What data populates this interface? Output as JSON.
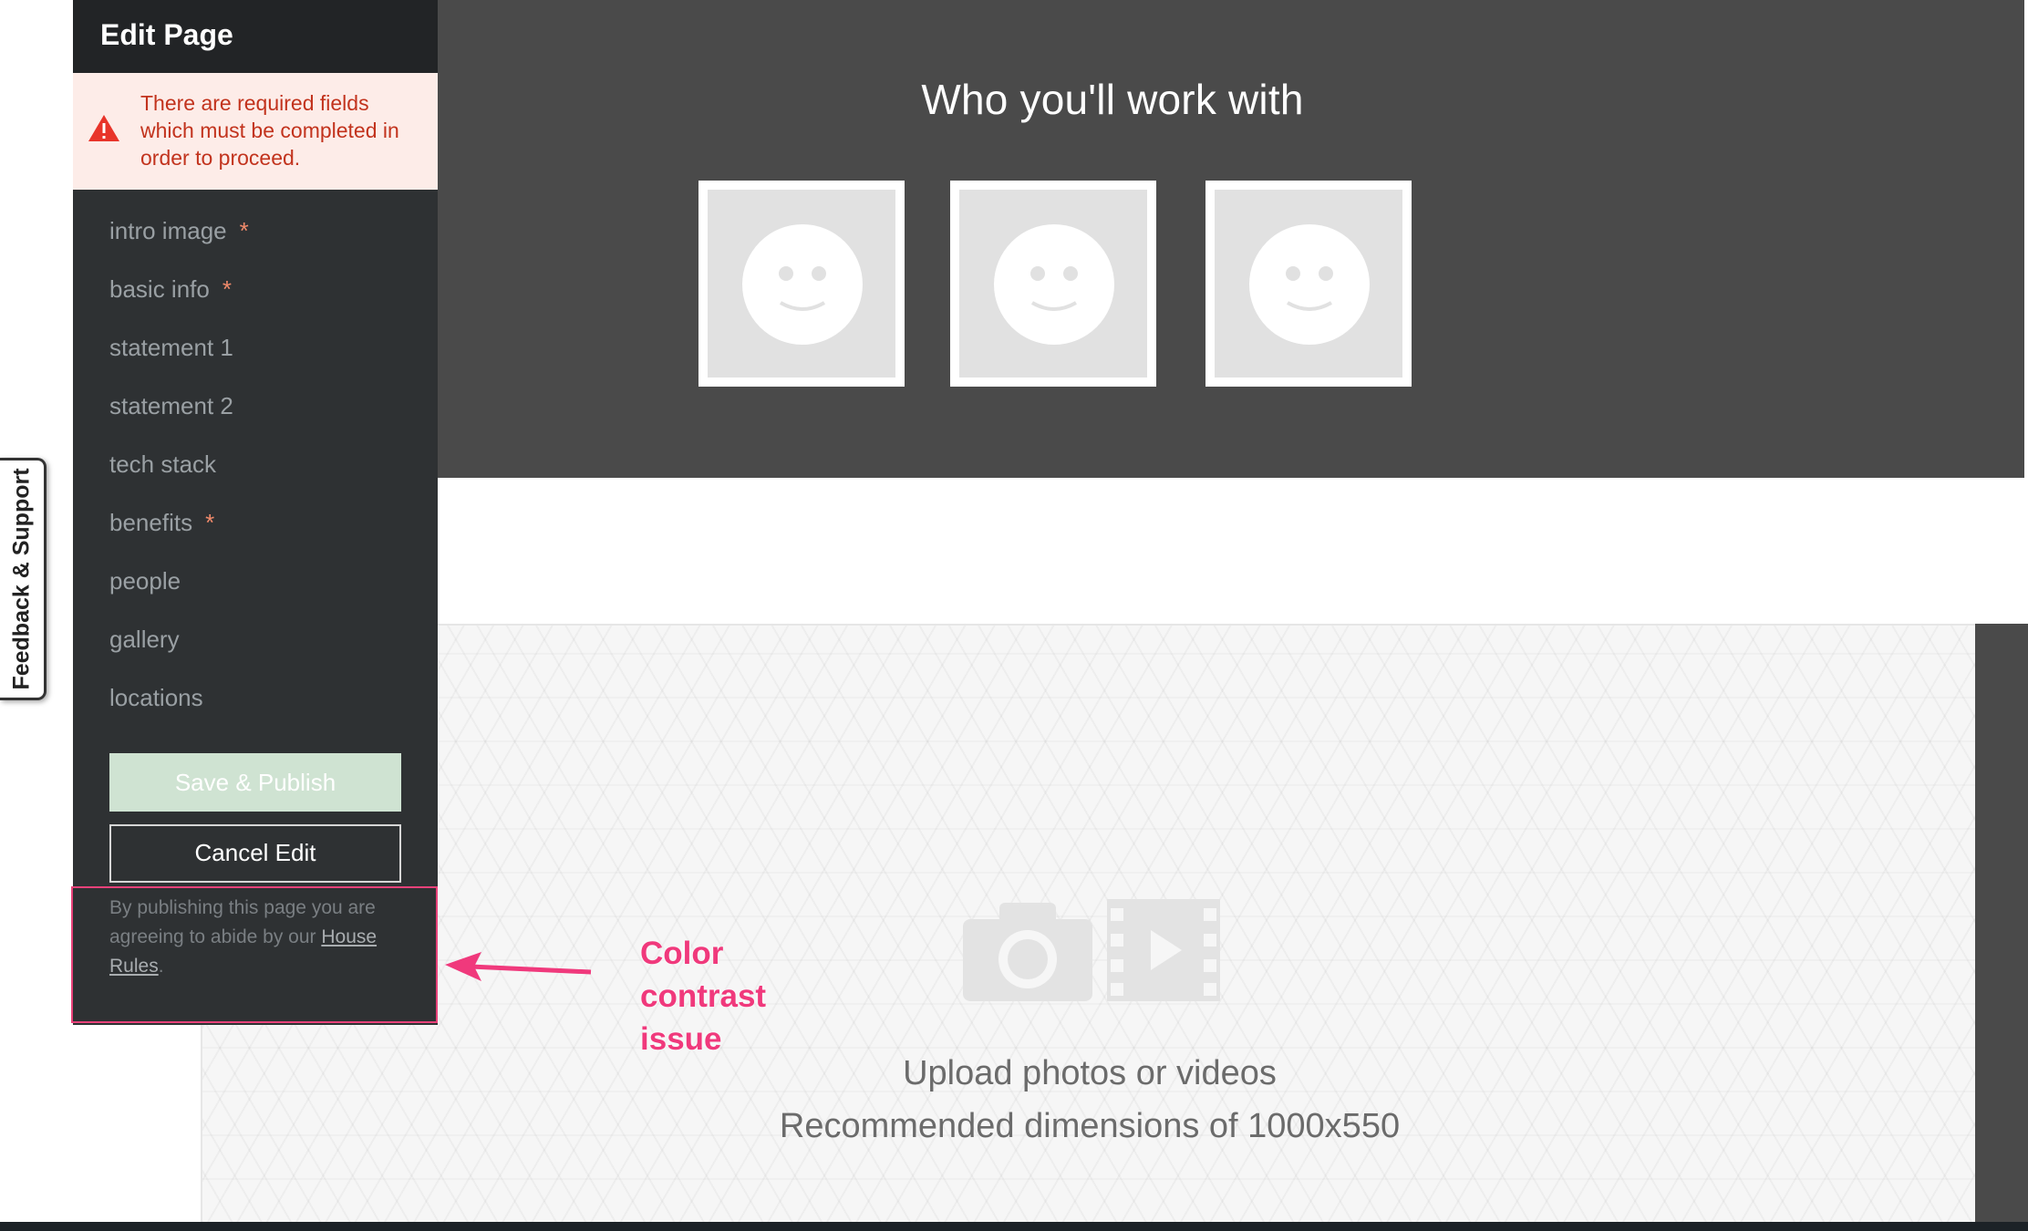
{
  "edit_panel": {
    "title": "Edit Page",
    "error_message": "There are required fields which must be completed in order to proceed.",
    "nav_items": [
      {
        "label": "intro image",
        "required_mark": "*"
      },
      {
        "label": "basic info",
        "required_mark": "*"
      },
      {
        "label": "statement 1",
        "required_mark": ""
      },
      {
        "label": "statement 2",
        "required_mark": ""
      },
      {
        "label": "tech stack",
        "required_mark": ""
      },
      {
        "label": "benefits",
        "required_mark": "*"
      },
      {
        "label": "people",
        "required_mark": ""
      },
      {
        "label": "gallery",
        "required_mark": ""
      },
      {
        "label": "locations",
        "required_mark": ""
      }
    ],
    "save_label": "Save & Publish",
    "cancel_label": "Cancel Edit",
    "disclaimer_prefix": "By publishing this page you are agreeing to abide by our",
    "house_rules_link": "House Rules",
    "disclaimer_suffix": "."
  },
  "people_section": {
    "title": "Who you'll work with",
    "placeholder_count": 3
  },
  "upload": {
    "line1": "Upload photos or videos",
    "line2": "Recommended dimensions of 1000x550",
    "icons": [
      "camera-icon",
      "video-icon"
    ]
  },
  "feedback_tab": {
    "label": "Feedback & Support"
  },
  "annotation": {
    "text_line1": "Color",
    "text_line2": "contrast",
    "text_line3": "issue",
    "color": "#f0397c"
  },
  "colors": {
    "panel_bg": "#2e3133",
    "error_text": "#c2331d",
    "save_disabled": "#cfe3d2",
    "section_bg": "#4a4a4a"
  }
}
